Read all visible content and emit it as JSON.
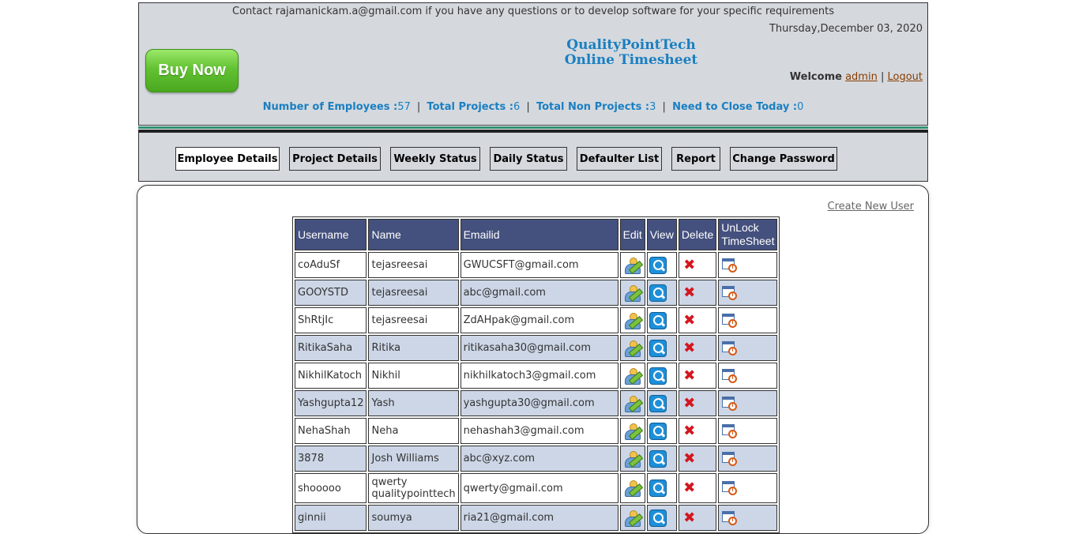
{
  "header": {
    "contact": "Contact rajamanickam.a@gmail.com if you have any questions or to develop software for your specific requirements",
    "date": "Thursday,December 03, 2020",
    "buy_now": "Buy Now",
    "title_line1": "QualityPointTech",
    "title_line2": "Online Timesheet",
    "welcome_label": "Welcome",
    "user": "admin",
    "separator": "|",
    "logout": "Logout",
    "stats": {
      "employees_label": "Number of Employees :",
      "employees_value": "57",
      "projects_label": "Total Projects :",
      "projects_value": "6",
      "non_projects_label": "Total Non Projects :",
      "non_projects_value": "3",
      "close_today_label": "Need to Close Today :",
      "close_today_value": "0",
      "sep": "|"
    }
  },
  "nav": {
    "employee_details": "Employee Details",
    "project_details": "Project Details",
    "weekly_status": "Weekly Status",
    "daily_status": "Daily Status",
    "defaulter_list": "Defaulter List",
    "report": "Report",
    "change_password": "Change Password"
  },
  "main": {
    "create_new_user": "Create New User",
    "table": {
      "headers": {
        "username": "Username",
        "name": "Name",
        "emailid": "Emailid",
        "edit": "Edit",
        "view": "View",
        "delete": "Delete",
        "unlock_1": "UnLock",
        "unlock_2": "TimeSheet"
      },
      "rows": [
        {
          "username": "coAduSf",
          "name": "tejasreesai",
          "email": "GWUCSFT@gmail.com"
        },
        {
          "username": "GOOYSTD",
          "name": "tejasreesai",
          "email": "abc@gmail.com"
        },
        {
          "username": "ShRtjIc",
          "name": "tejasreesai",
          "email": "ZdAHpak@gmail.com"
        },
        {
          "username": "RitikaSaha",
          "name": "Ritika",
          "email": "ritikasaha30@gmail.com"
        },
        {
          "username": "NikhilKatoch",
          "name": "Nikhil",
          "email": "nikhilkatoch3@gmail.com"
        },
        {
          "username": "Yashgupta12",
          "name": "Yash",
          "email": "yashgupta30@gmail.com"
        },
        {
          "username": "NehaShah",
          "name": "Neha",
          "email": "nehashah3@gmail.com"
        },
        {
          "username": "3878",
          "name": "Josh Williams",
          "email": "abc@xyz.com"
        },
        {
          "username": "shooooo",
          "name": "qwerty qualitypointtech",
          "email": "qwerty@gmail.com"
        },
        {
          "username": "ginnii",
          "name": "soumya",
          "email": "ria21@gmail.com"
        }
      ]
    }
  },
  "icons": {
    "edit": "edit-user-icon",
    "view": "view-icon",
    "delete": "delete-icon",
    "unlock": "unlock-timesheet-icon"
  }
}
